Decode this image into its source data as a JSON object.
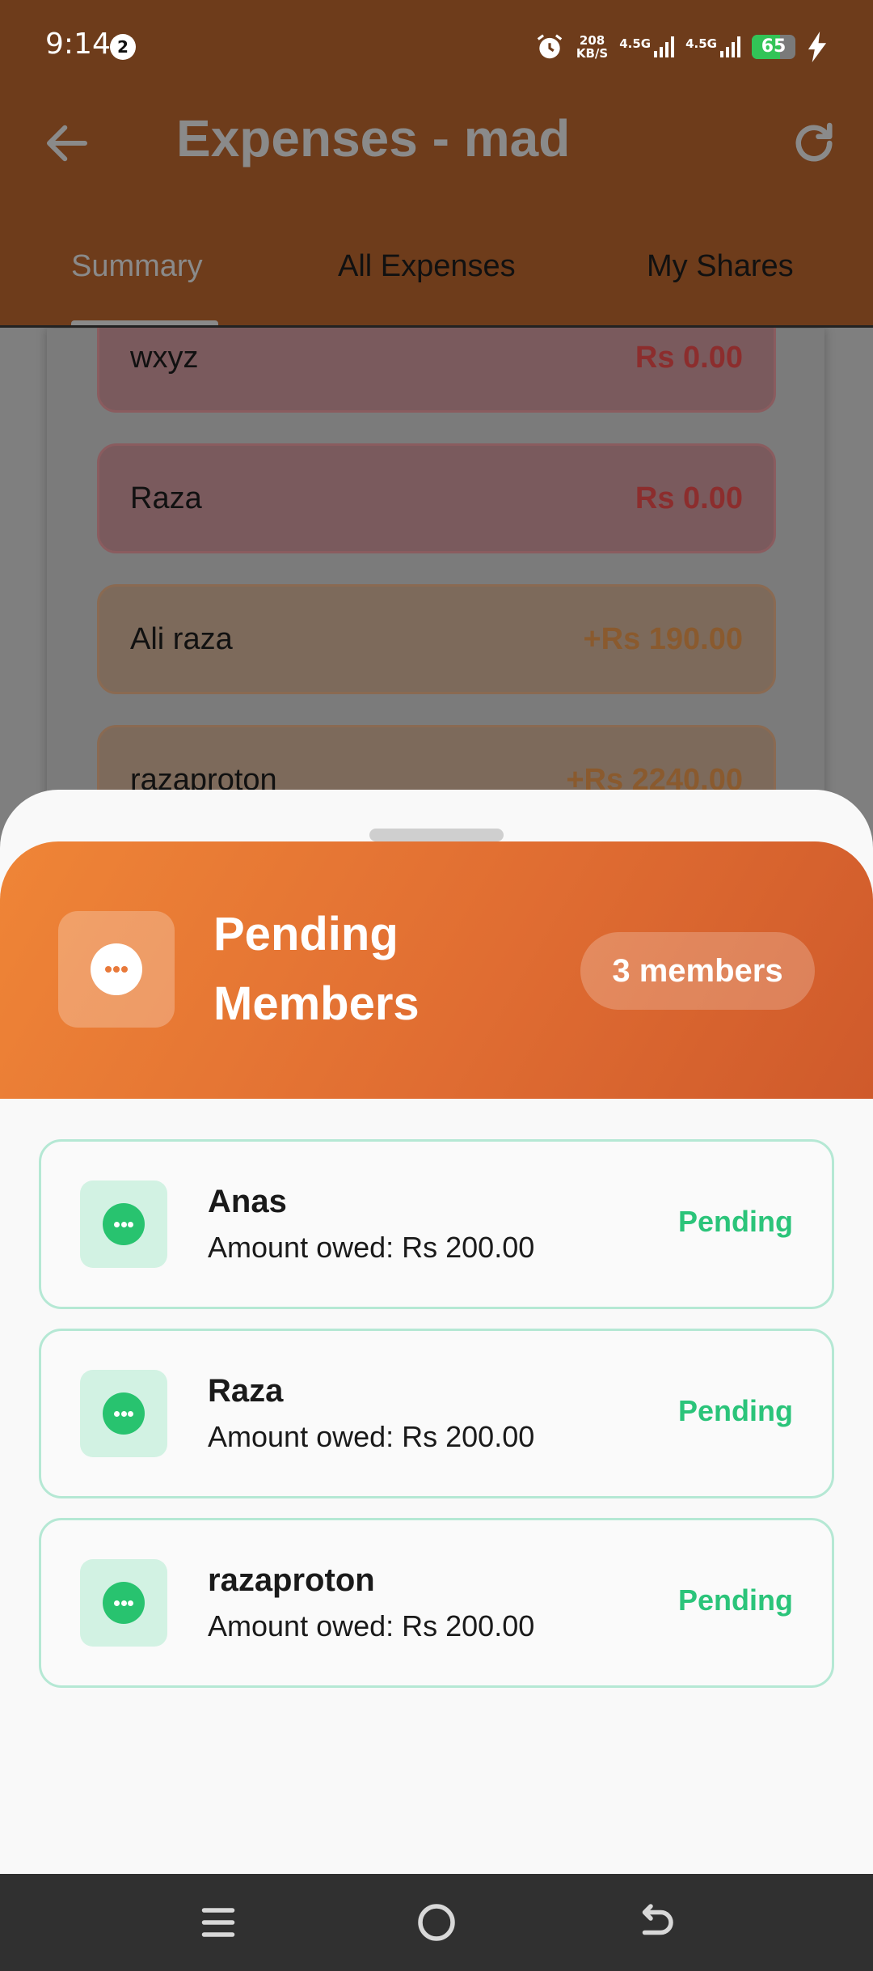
{
  "status_bar": {
    "time": "9:14",
    "notification_count": "2",
    "speed_value": "208",
    "speed_unit": "KB/S",
    "network1": "4.5G",
    "network2": "4.5G",
    "battery": "65",
    "battery_level": 0.65,
    "battery_color": "#32c457"
  },
  "app_bar": {
    "title": "Expenses - mad",
    "back_icon": "arrow-left-icon",
    "refresh_icon": "refresh-icon"
  },
  "tabs": [
    {
      "label": "Summary",
      "active": true
    },
    {
      "label": "All Expenses",
      "active": false
    },
    {
      "label": "My Shares",
      "active": false
    }
  ],
  "balances": [
    {
      "name": "wxyz",
      "amount": "Rs 0.00",
      "kind": "negative"
    },
    {
      "name": "Raza",
      "amount": "Rs 0.00",
      "kind": "negative"
    },
    {
      "name": "Ali raza",
      "amount": "+Rs 190.00",
      "kind": "positive"
    },
    {
      "name": "razaproton",
      "amount": "+Rs 2240.00",
      "kind": "positive"
    }
  ],
  "sheet": {
    "title": "Pending Members",
    "member_count": "3 members",
    "header_icon": "more-horizontal-icon",
    "accent": "#e8793a",
    "members": [
      {
        "name": "Anas",
        "owed": "Amount owed: Rs 200.00",
        "status": "Pending"
      },
      {
        "name": "Raza",
        "owed": "Amount owed: Rs 200.00",
        "status": "Pending"
      },
      {
        "name": "razaproton",
        "owed": "Amount owed: Rs 200.00",
        "status": "Pending"
      }
    ],
    "status_color": "#2bc47a"
  },
  "nav_bar": {
    "menu_icon": "menu-icon",
    "home_icon": "home-circle-icon",
    "back_icon": "back-arrow-icon"
  }
}
